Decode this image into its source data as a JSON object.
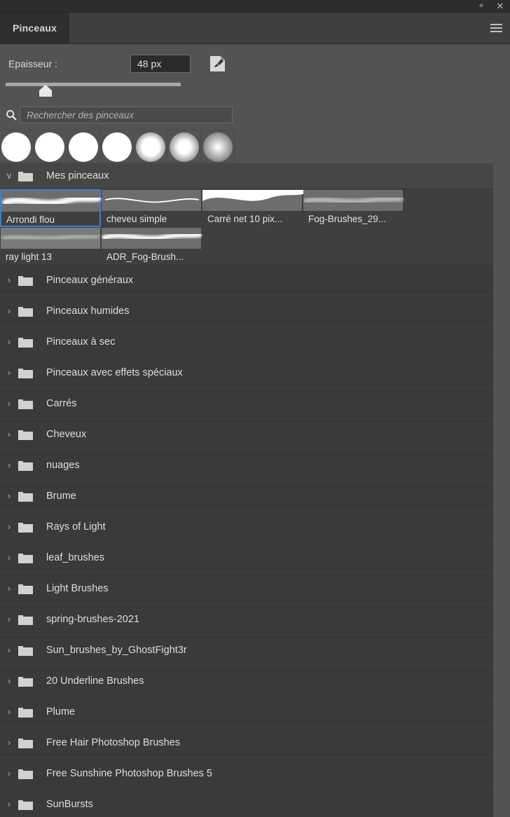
{
  "window": {
    "collapse_icon": "chevrons-left-icon",
    "collapse_label": "«",
    "close_label": "✕"
  },
  "tab": {
    "label": "Pinceaux",
    "menu_icon": "hamburger-menu-icon"
  },
  "thickness": {
    "label": "Epaisseur :",
    "value": "48 px",
    "slider_percent": 22,
    "new_brush_icon": "brush-preset-icon"
  },
  "search": {
    "icon": "search-icon",
    "placeholder": "Rechercher des pinceaux",
    "value": ""
  },
  "brush_tips": [
    {
      "name": "hard-round-1",
      "softness": 0
    },
    {
      "name": "hard-round-2",
      "softness": 4
    },
    {
      "name": "soft-round-1",
      "softness": 12
    },
    {
      "name": "soft-round-2",
      "softness": 16
    },
    {
      "name": "soft-round-3",
      "softness": 38
    },
    {
      "name": "soft-round-4",
      "softness": 45
    },
    {
      "name": "soft-round-5",
      "softness": 62
    }
  ],
  "group": {
    "label": "Mes pinceaux",
    "expanded": true,
    "chevron": "∨"
  },
  "brushes": [
    {
      "label": "Arrondi flou",
      "selected": true,
      "stroke": "blurred-round"
    },
    {
      "label": "cheveu simple",
      "selected": false,
      "stroke": "thin-hair"
    },
    {
      "label": "Carré net 10 pix...",
      "selected": false,
      "stroke": "hard-square"
    },
    {
      "label": "Fog-Brushes_29...",
      "selected": false,
      "stroke": "fog"
    },
    {
      "label": "ray light 13",
      "selected": false,
      "stroke": "ray-light"
    },
    {
      "label": "ADR_Fog-Brush...",
      "selected": false,
      "stroke": "fog-bold"
    }
  ],
  "folders": [
    {
      "label": "Pinceaux généraux"
    },
    {
      "label": "Pinceaux humides"
    },
    {
      "label": "Pinceaux à sec"
    },
    {
      "label": "Pinceaux avec effets spéciaux"
    },
    {
      "label": "Carrés"
    },
    {
      "label": "Cheveux"
    },
    {
      "label": "nuages"
    },
    {
      "label": "Brume"
    },
    {
      "label": "Rays of Light"
    },
    {
      "label": "leaf_brushes"
    },
    {
      "label": "Light Brushes"
    },
    {
      "label": "spring-brushes-2021"
    },
    {
      "label": "Sun_brushes_by_GhostFight3r"
    },
    {
      "label": "20 Underline Brushes"
    },
    {
      "label": "Plume"
    },
    {
      "label": "Free Hair Photoshop Brushes"
    },
    {
      "label": "Free Sunshine Photoshop Brushes 5"
    },
    {
      "label": "SunBursts"
    }
  ],
  "colors": {
    "panel_bg": "#535353",
    "list_bg": "#3a3a3a",
    "group_bg": "#464646",
    "tab_active": "#2e2e2e",
    "accent_selection": "#3a7fd5",
    "text": "#dedede"
  },
  "collapsed_chevron": "›"
}
